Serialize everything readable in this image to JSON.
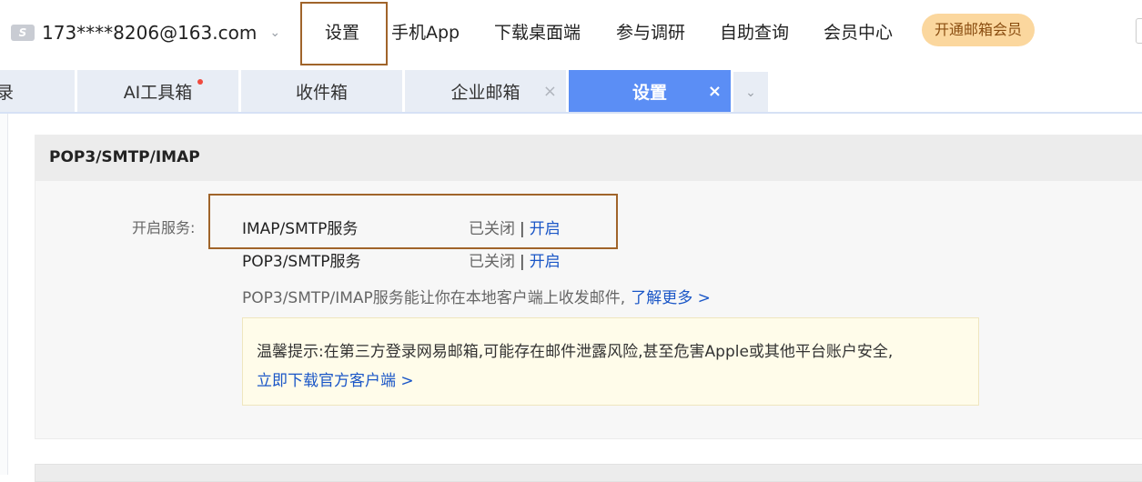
{
  "topbar": {
    "account_icon_letter": "S",
    "account_email": "173****8206@163.com",
    "account_chevron": "⌄",
    "nav": [
      "设置",
      "手机App",
      "下载桌面端",
      "参与调研",
      "自助查询",
      "会员中心"
    ],
    "vip_button": "开通邮箱会员"
  },
  "tabs": [
    {
      "label": "录"
    },
    {
      "label": "AI工具箱"
    },
    {
      "label": "收件箱"
    },
    {
      "label": "企业邮箱",
      "close": "×"
    },
    {
      "label": "设置",
      "close": "×"
    }
  ],
  "tab_more": "⌄",
  "panel": {
    "title": "POP3/SMTP/IMAP",
    "service_label": "开启服务:",
    "services": [
      {
        "name": "IMAP/SMTP服务",
        "status": "已关闭",
        "sep": "|",
        "action": "开启"
      },
      {
        "name": "POP3/SMTP服务",
        "status": "已关闭",
        "sep": "|",
        "action": "开启"
      }
    ],
    "description": "POP3/SMTP/IMAP服务能让你在本地客户端上收发邮件,",
    "learn_more": "了解更多 >",
    "tip_text": "温馨提示:在第三方登录网易邮箱,可能存在邮件泄露风险,甚至危害Apple或其他平台账户安全,",
    "tip_link": "立即下载官方客户端 >"
  },
  "colors": {
    "accent": "#5b8ef5",
    "link": "#1a56c7",
    "highlight_border": "#a0642a",
    "vip_bg": "#fbd79e"
  }
}
